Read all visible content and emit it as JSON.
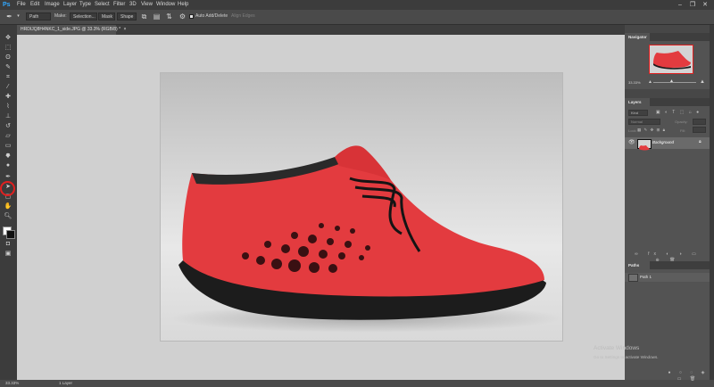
{
  "app": {
    "logo": "Ps"
  },
  "menu": [
    "File",
    "Edit",
    "Image",
    "Layer",
    "Type",
    "Select",
    "Filter",
    "3D",
    "View",
    "Window",
    "Help"
  ],
  "options_bar": {
    "mode_select": "Path",
    "make_label": "Make:",
    "selection_button": "Selection...",
    "mask_button": "Mask",
    "shape_button": "Shape",
    "auto_add_delete_label": "Auto Add/Delete",
    "align_edges_label": "Align Edges",
    "auto_add_delete_checked": true
  },
  "document_tab": {
    "title": "HRDIJQ8H4NKC_1_side.JPG @ 33.3% (RGB/8) *"
  },
  "status_bar": {
    "zoom": "33.33%",
    "info": "1 Layer"
  },
  "navigator": {
    "tab": "Navigator",
    "zoom": "33.33%"
  },
  "layers": {
    "tab": "Layers",
    "kind_filter": "Kind",
    "blend_mode": "Normal",
    "opacity_label": "Opacity:",
    "lock_label": "Lock:",
    "fill_label": "Fill:",
    "items": [
      {
        "name": "Background",
        "visible": true,
        "locked": true
      }
    ]
  },
  "paths": {
    "tab": "Paths",
    "items": [
      {
        "name": "Path 1"
      }
    ]
  },
  "watermark": {
    "line1": "Activate Windows",
    "line2": "Go to Settings to activate Windows."
  },
  "icons": {
    "toolbar": [
      "move-icon",
      "marquee-icon",
      "lasso-icon",
      "quick-select-icon",
      "crop-icon",
      "eyedropper-icon",
      "healing-icon",
      "brush-icon",
      "clone-stamp-icon",
      "history-brush-icon",
      "eraser-icon",
      "gradient-icon",
      "blur-icon",
      "dodge-icon",
      "pen-icon",
      "type-icon",
      "path-select-icon",
      "shape-icon",
      "hand-icon",
      "zoom-icon"
    ]
  },
  "colors": {
    "highlight": "#e02020",
    "accent": "#31a8ff",
    "shoe": "#e33b3f"
  }
}
